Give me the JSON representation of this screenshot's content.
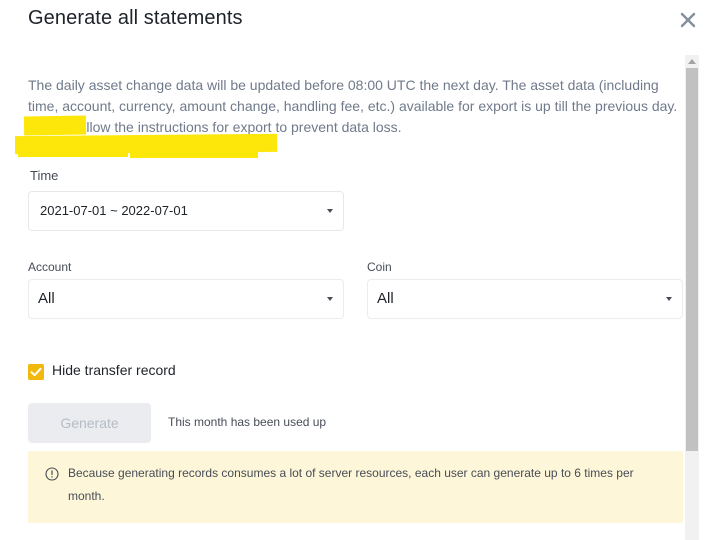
{
  "dialog": {
    "title": "Generate all statements",
    "close_icon": "close-icon"
  },
  "info_text": "The daily asset change data will be updated before 08:00 UTC the next day. The asset data (including time, account, currency, amount change, handling fee, etc.) available for export is up till the previous day. Please follow the instructions for export to prevent data loss.",
  "time": {
    "label": "Time",
    "value": "2021-07-01 ~ 2022-07-01",
    "highlight_color": "#fde60a"
  },
  "account": {
    "label": "Account",
    "value": "All"
  },
  "coin": {
    "label": "Coin",
    "value": "All"
  },
  "hide_transfer": {
    "label": "Hide transfer record",
    "checked": true,
    "color": "#f0b90b"
  },
  "generate": {
    "label": "Generate",
    "note": "This month has been used up",
    "enabled": false
  },
  "warning": {
    "icon": "info-circle-icon",
    "text": "Because generating records consumes a lot of server resources, each user can generate up to 6 times per month."
  }
}
